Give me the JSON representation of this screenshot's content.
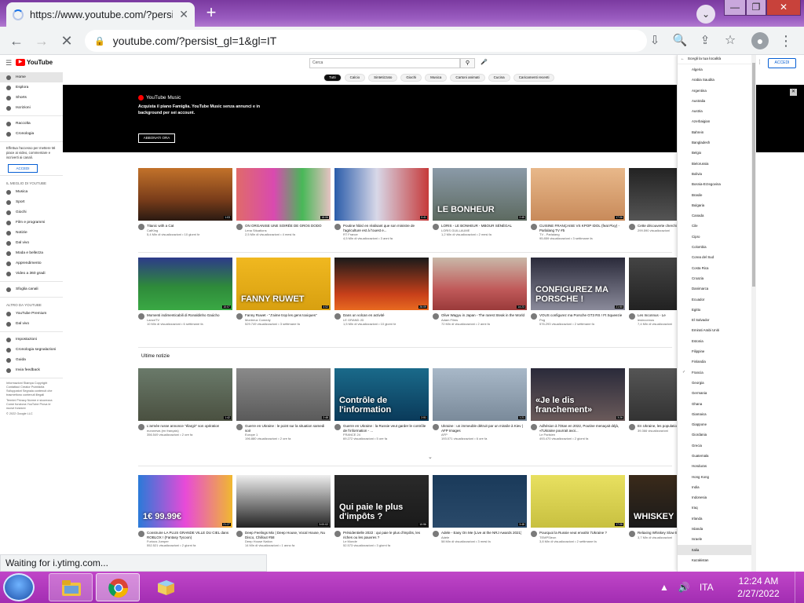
{
  "browser": {
    "tab_title": "https://www.youtube.com/?persi",
    "new_tab": "+",
    "tab_close": "✕",
    "url": "youtube.com/?persist_gl=1&gl=IT",
    "status_text": "Waiting for i.ytimg.com..."
  },
  "yt": {
    "search_placeholder": "Cerca",
    "signin": "ACCEDI",
    "sidebar_main": [
      "Home",
      "Esplora",
      "Shorts",
      "Iscrizioni"
    ],
    "sidebar_lib": [
      "Raccolta",
      "Cronologia"
    ],
    "sidebar_promo": "Effettua l'accesso per mettere Mi piace ai video, commentare e iscriverti ai canali.",
    "sidebar_signin": "ACCEDI",
    "best_heading": "IL MEGLIO DI YOUTUBE",
    "sidebar_best": [
      "Musica",
      "Sport",
      "Giochi",
      "Film e programmi",
      "Notizie",
      "Dal vivo",
      "Moda e bellezza",
      "Apprendimento",
      "Video a 360 gradi"
    ],
    "sidebar_browse": "Sfoglia canali",
    "more_heading": "ALTRO DA YOUTUBE",
    "sidebar_more": [
      "YouTube Premium",
      "Dal vivo"
    ],
    "sidebar_settings": [
      "Impostazioni",
      "Cronologia segnalazioni",
      "Guida",
      "Invia feedback"
    ],
    "footer_1": "Informazioni Stampa Copyright Contattaci Creator Pubblicità Sviluppatori Segnala contenuti che trasmettono contenuti illegali",
    "footer_2": "Termini Privacy Norme e sicurezza Come funziona YouTube Prova le nuove funzioni",
    "footer_3": "© 2022 Google LLC",
    "chips": [
      "Tutti",
      "Calcio",
      "Sintetizzato",
      "Giochi",
      "Musica",
      "Cartoni animati",
      "Cucina",
      "Caricamenti recenti"
    ],
    "banner_brand": "YouTube Music",
    "banner_text": "Acquista il piano Famiglia. YouTube Music senza annunci e in background per sei account.",
    "banner_button": "ABBONATI ORA",
    "news_title": "Ultime notizie",
    "row1": [
      {
        "title": "Titanic with a Cat",
        "channel": "CatKing",
        "stats": "5,4 Mln di visualizzazioni • 10 giorni fa",
        "dur": "1:03",
        "bg": "linear-gradient(#c2722a,#7a3d1a 60%,#2a1a12)"
      },
      {
        "title": "ON ORGANISE UNE SOIRÉE DE GROS DODO",
        "channel": "Lena Situations",
        "stats": "2,5 Mln di visualizzazioni • 4 mesi fa",
        "dur": "18:06",
        "bg": "linear-gradient(90deg,#e06a6a,#d94ab0 40%,#48b858 70%,#e6c2c2)"
      },
      {
        "title": "Poutine hlásí en réalisant que son ministre de l'agriculture est à l'ouest e...",
        "channel": "RT France",
        "stats": "4,5 Mln di visualizzazioni • 3 anni fa",
        "dur": "0:41",
        "bg": "linear-gradient(90deg,#2a5caa,#d8d8e8 45%,#c63a3a)"
      },
      {
        "title": "LORIS - LE BONHEUR - MBOUR SÉNÉGAL",
        "channel": "LORIS GUILLAUME",
        "stats": "1,2 Mln di visualizzazioni • 2 mesi fa",
        "dur": "2:45",
        "bg": "linear-gradient(#8a9aa8,#5d6a60)",
        "cap": "LE BONHEUR"
      },
      {
        "title": "CUISINE FRANÇAISE VS KPOP IDOL (feat Pixy) - Parlalang TV #5",
        "channel": "TV - Parlalang",
        "stats": "95.859 visualizzazioni • 3 settimane fa",
        "dur": "17:06",
        "bg": "linear-gradient(#e8b88a,#c88a5a)"
      },
      {
        "title": "Cette découverte cherchions l",
        "channel": "",
        "stats": "299.590 visualizzazioni",
        "dur": "",
        "bg": "linear-gradient(#222,#555)"
      }
    ],
    "row2": [
      {
        "title": "Momenti indimenticabili di Ronaldinho Gaúcho",
        "channel": "LanceTV",
        "stats": "10 Mln di visualizzazioni • 6 settimane fa",
        "dur": "10:07",
        "bg": "linear-gradient(#2d3a8a,#2e8a3a 55%,#3aa844)"
      },
      {
        "title": "Fanny Ruwet - \"J'aime trop les gens toxiques\"",
        "channel": "Montreux Comedy",
        "stats": "529.749 visualizzazioni • 3 settimane fa",
        "dur": "4:02",
        "bg": "linear-gradient(#f0b820,#d8a010)",
        "cap": "FANNY RUWET"
      },
      {
        "title": "Dans un volcan en activité",
        "channel": "LE GRAND JD",
        "stats": "1,5 Mln di visualizzazioni • 10 giorni fa",
        "dur": "26:09",
        "bg": "linear-gradient(#1a1a1a,#c8401a 70%,#e86a20)"
      },
      {
        "title": "Olive Wagyu in Japan - The rarest Steak in the World",
        "channel": "Adam Films",
        "stats": "72 Mln di visualizzazioni • 2 anni fa",
        "dur": "14:23",
        "bg": "linear-gradient(#c9b8a8,#c05a5a 60%,#9a3a3a)"
      },
      {
        "title": "VOUS configurez ma Porsche GT3 RS ! Ft Squeezie",
        "channel": "Pog",
        "stats": "576.293 visualizzazioni • 2 settimane fa",
        "dur": "21:50",
        "bg": "linear-gradient(#2a2a3a,#8a8a9a)",
        "cap": "CONFIGUREZ MA PORSCHE !"
      },
      {
        "title": "Les Inconnus - Le",
        "channel": "lesinconnus",
        "stats": "7,4 Mln di visualizzazioni",
        "dur": "",
        "bg": "linear-gradient(#444,#222)"
      }
    ],
    "row3": [
      {
        "title": "L'armée russe annonce \"élargir\" son opération",
        "channel": "euronews (en français)",
        "stats": "356.549 visualizzazioni • 2 ore fa",
        "dur": "1:42",
        "bg": "linear-gradient(#6a7a6a,#4a5040)"
      },
      {
        "title": "Guerre en Ukraine : le point sur la situation samedi soir",
        "channel": "Europe 1",
        "stats": "196.880 visualizzazioni • 2 ore fa",
        "dur": "2:48",
        "bg": "linear-gradient(#8a8a8a,#5a5a5a)"
      },
      {
        "title": "Guerre en Ukraine : la Russie veut garder le contrôle de l'information - ...",
        "channel": "FRANCE 24",
        "stats": "69.272 visualizzazioni • 5 ore fa",
        "dur": "2:51",
        "bg": "linear-gradient(#1a6a8a,#0a3a5a)",
        "cap": "Contrôle de l'information"
      },
      {
        "title": "Ukraine : un immeuble détruit par un missile à Kiev | AFP Images",
        "channel": "AFP",
        "stats": "193.071 visualizzazioni • 6 ore fa",
        "dur": "1:21",
        "bg": "linear-gradient(#a8b8c8,#7a8a9a)"
      },
      {
        "title": "Adhésion à l'Otan en 2022, Poutine menaçait déjà, «l'Ukraine pourrait avoi...",
        "channel": "Le Parisien",
        "stats": "493.470 visualizzazioni • 2 giorni fa",
        "dur": "3:26",
        "bg": "linear-gradient(#2a2a3a,#6a5a5a)",
        "cap": "«Je le dis franchement»"
      },
      {
        "title": "En Ukraine, les populations fuient",
        "channel": "",
        "stats": "39.366 visualizzazioni",
        "dur": "",
        "bg": "linear-gradient(#555,#333)"
      }
    ],
    "row4": [
      {
        "title": "Construire LA PLUS GRANDE VILLE DU CIEL dans ROBLOX ! (Fantasy Tycoon)",
        "channel": "Furious Jumper",
        "stats": "552.521 visualizzazioni • 2 giorni fa",
        "dur": "21:27",
        "bg": "linear-gradient(90deg,#2a7ad8,#e84ad8 50%,#f0b830)",
        "cap": "1€   99.99€"
      },
      {
        "title": "Deep Feelings Mix | Deep House, Vocal House, Nu Disco, Chillout #58",
        "channel": "Deep House Nation",
        "stats": "14 Mln di visualizzazioni • 1 anno fa",
        "dur": "3:00:02",
        "bg": "linear-gradient(#eee,#222)"
      },
      {
        "title": "Présidentielle 2022 : qui paie le plus d'impôts, les riches ou les pauvres ?",
        "channel": "Le Monde",
        "stats": "52.573 visualizzazioni • 3 giorni fa",
        "dur": "10:56",
        "bg": "linear-gradient(#2a2a2a,#1a1a1a)",
        "cap": "Qui paie le plus d'impôts ?"
      },
      {
        "title": "Adele - Easy On Me (Live at the NRJ Awards 2021)",
        "channel": "Adele",
        "stats": "58 Mln di visualizzazioni • 3 mesi fa",
        "dur": "3:48",
        "bg": "linear-gradient(#1a3a5a,#2a4a6a)"
      },
      {
        "title": "Pourquoi la Russie veut envahir l'Ukraine ?",
        "channel": "TEMPSleon",
        "stats": "3,8 Mln di visualizzazioni • 2 settimane fa",
        "dur": "17:08",
        "bg": "linear-gradient(#e8e060,#c8c040)"
      },
      {
        "title": "Relaxing Whiskey Slow Blues / Rock",
        "channel": "",
        "stats": "3,7 Mln di visualizzazioni",
        "dur": "",
        "bg": "linear-gradient(#3a2a1a,#1a1a1a)",
        "cap": "WHISKEY BLUE"
      }
    ],
    "dropdown_title": "Scegli la tua località",
    "countries": [
      "Algeria",
      "Arabia Saudita",
      "Argentina",
      "Australia",
      "Austria",
      "Azerbaigian",
      "Bahrein",
      "Bangladesh",
      "Belgio",
      "Bielorussia",
      "Bolivia",
      "Bosnia-Erzegovina",
      "Brasile",
      "Bulgaria",
      "Canada",
      "Cile",
      "Cipro",
      "Colombia",
      "Corea del Sud",
      "Costa Rica",
      "Croazia",
      "Danimarca",
      "Ecuador",
      "Egitto",
      "El Salvador",
      "Emirati Arabi Uniti",
      "Estonia",
      "Filippine",
      "Finlandia",
      "Francia",
      "Georgia",
      "Germania",
      "Ghana",
      "Giamaica",
      "Giappone",
      "Giordania",
      "Grecia",
      "Guatemala",
      "Honduras",
      "Hong Kong",
      "India",
      "Indonesia",
      "Iraq",
      "Irlanda",
      "Islanda",
      "Israele",
      "Italia",
      "Kazakistan"
    ],
    "selected_country": "Francia",
    "hover_country": "Italia"
  },
  "taskbar": {
    "language": "ITA",
    "time": "12:24 AM",
    "date": "2/27/2022"
  },
  "colors": {
    "yt_red": "#ff0000",
    "link_blue": "#065fd4",
    "taskbar": "#a22db2"
  }
}
